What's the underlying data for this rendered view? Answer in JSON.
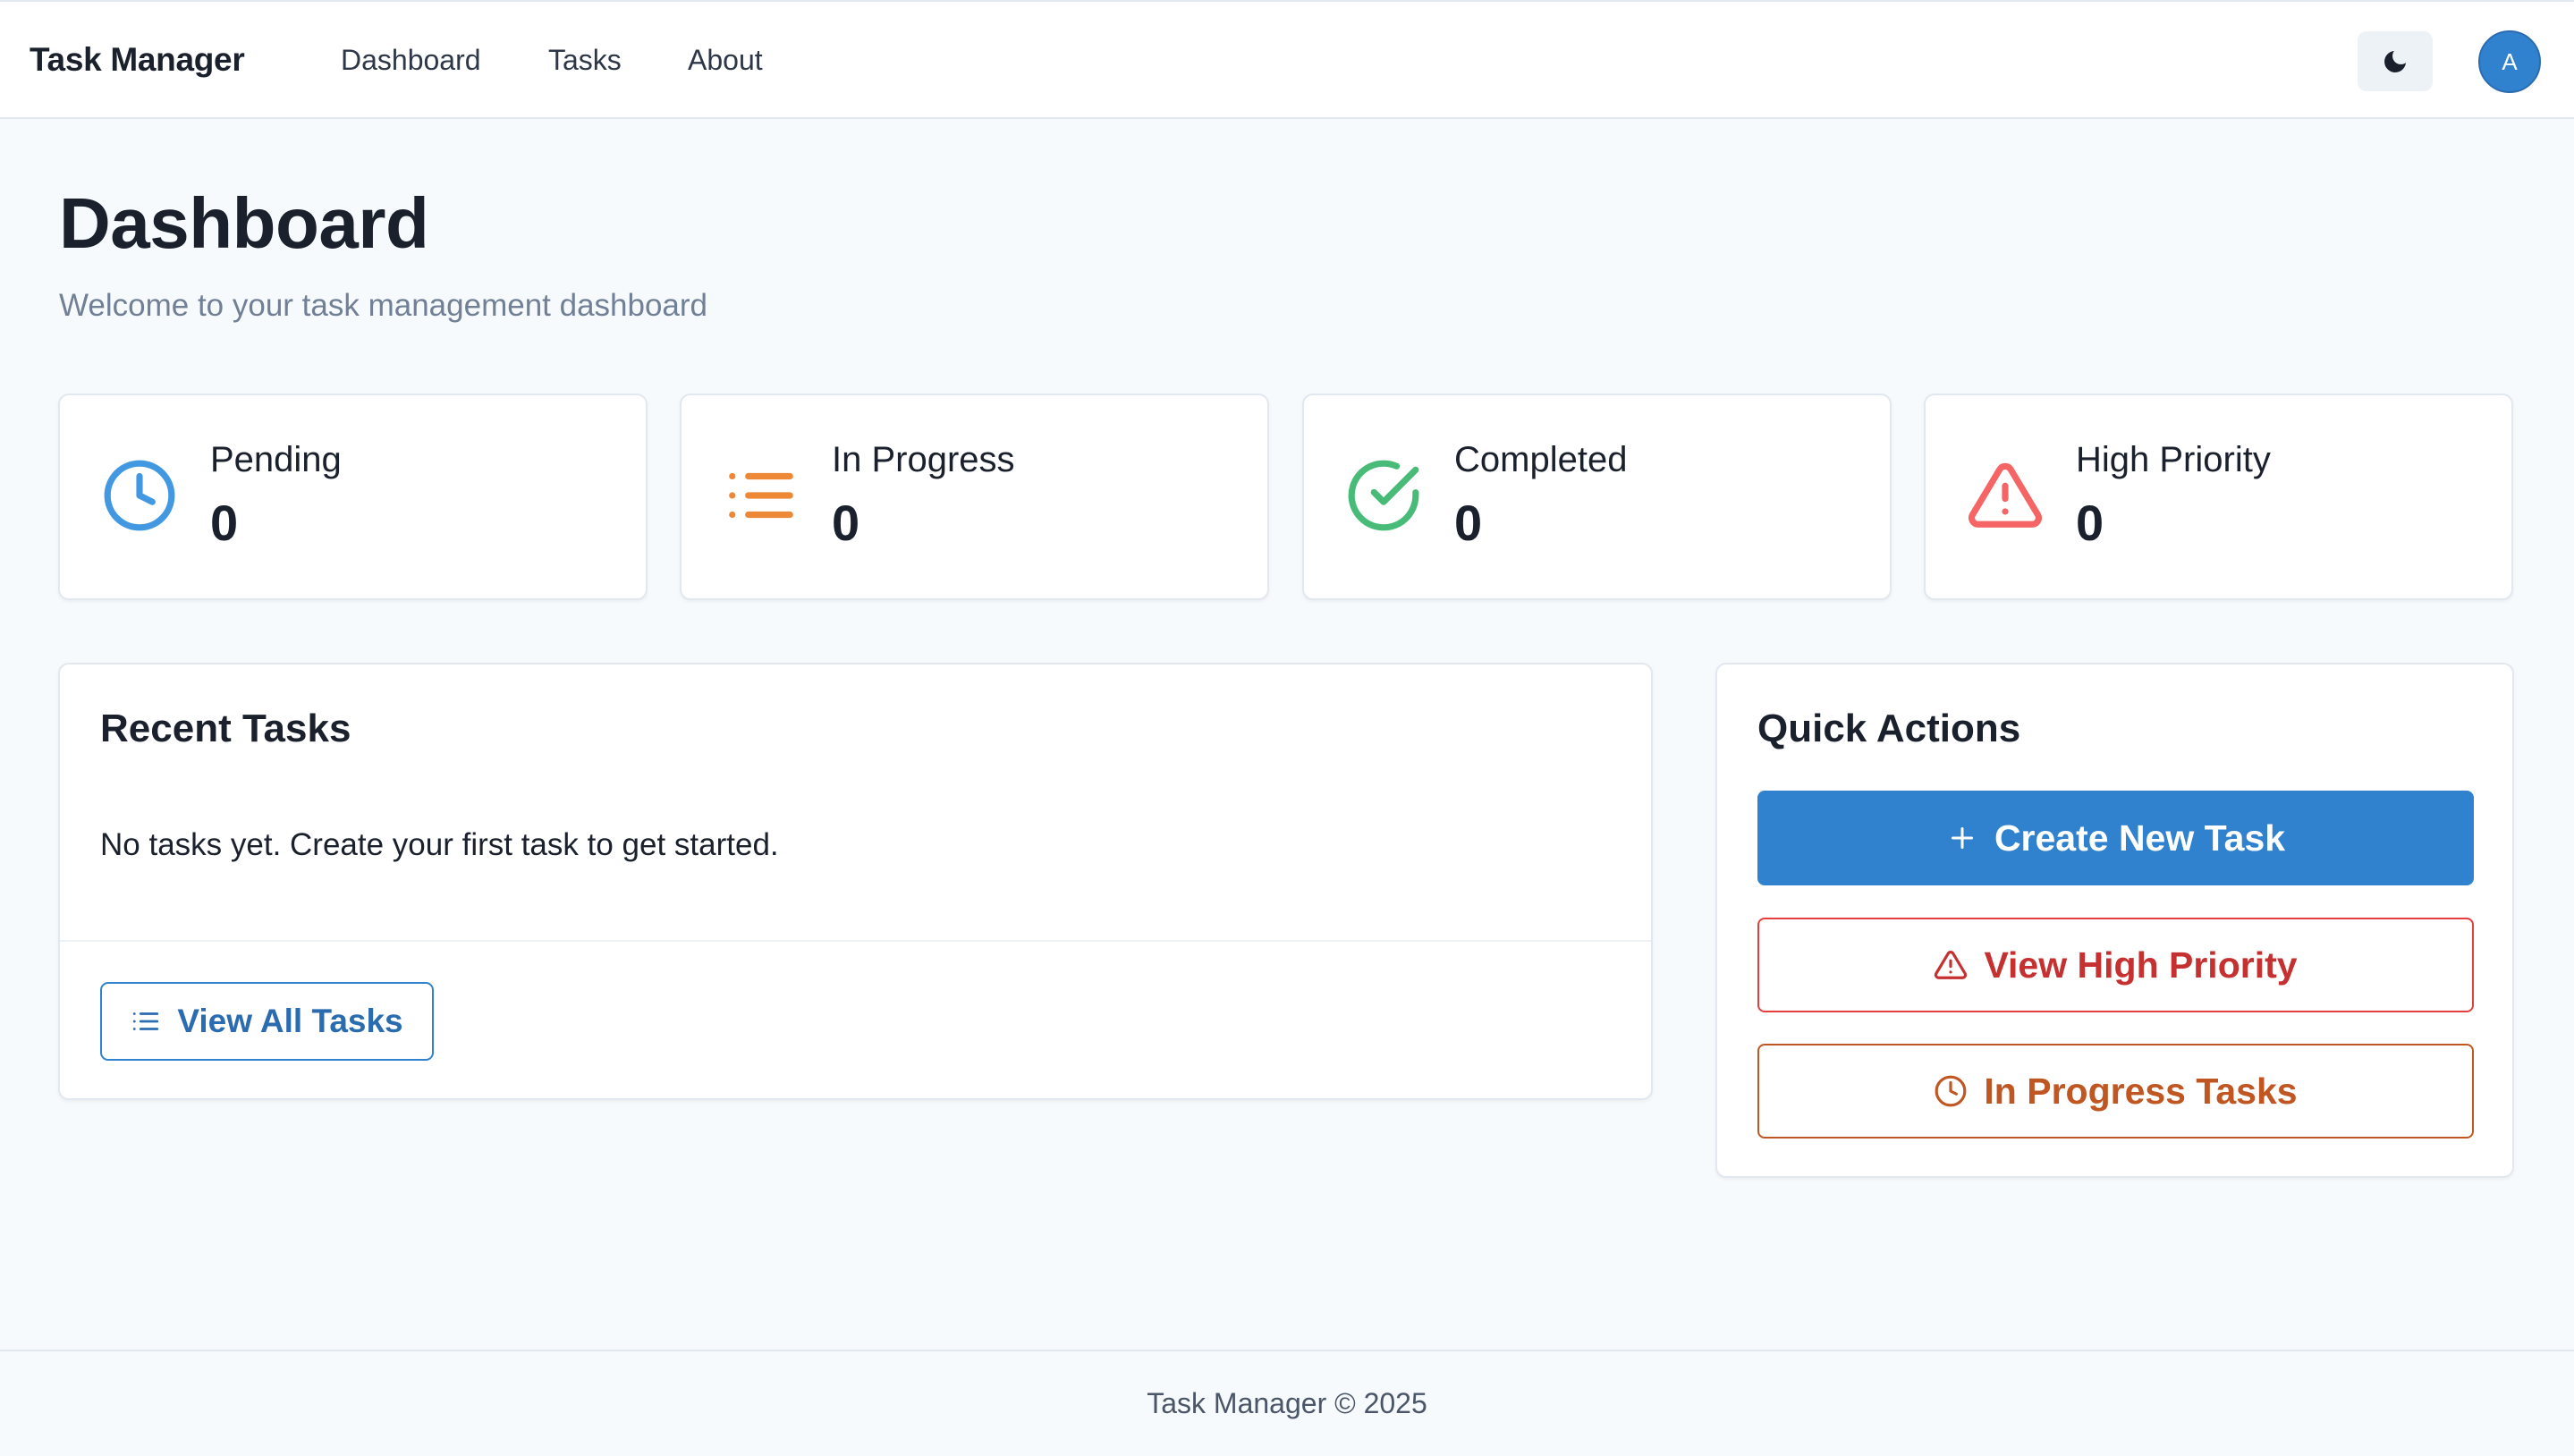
{
  "header": {
    "brand": "Task Manager",
    "nav": [
      "Dashboard",
      "Tasks",
      "About"
    ],
    "theme_icon": "moon-icon",
    "avatar_initial": "A"
  },
  "page": {
    "title": "Dashboard",
    "subtitle": "Welcome to your task management dashboard"
  },
  "stats": [
    {
      "label": "Pending",
      "value": "0",
      "icon": "clock-icon",
      "color": "#4299e1"
    },
    {
      "label": "In Progress",
      "value": "0",
      "icon": "list-icon",
      "color": "#ed8936"
    },
    {
      "label": "Completed",
      "value": "0",
      "icon": "check-circle-icon",
      "color": "#48bb78"
    },
    {
      "label": "High Priority",
      "value": "0",
      "icon": "warning-triangle-icon",
      "color": "#f56565"
    }
  ],
  "recent_tasks": {
    "title": "Recent Tasks",
    "empty_message": "No tasks yet. Create your first task to get started.",
    "view_all_label": "View All Tasks"
  },
  "quick_actions": {
    "title": "Quick Actions",
    "create_label": "Create New Task",
    "high_priority_label": "View High Priority",
    "in_progress_label": "In Progress Tasks"
  },
  "footer": {
    "text": "Task Manager © 2025"
  },
  "colors": {
    "primary": "#3182ce",
    "danger": "#e53e3e",
    "warning": "#c05621",
    "background": "#f7fafc"
  }
}
